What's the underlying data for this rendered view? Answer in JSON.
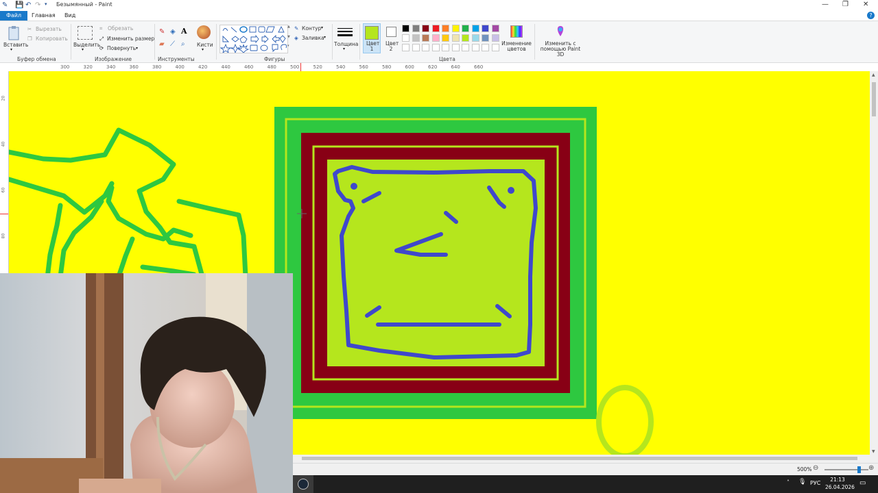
{
  "window": {
    "title": "Безымянный - Paint",
    "min_glyph": "—",
    "max_glyph": "❐",
    "close_glyph": "✕"
  },
  "menu": {
    "tabs": [
      {
        "label": "Файл",
        "active": true
      },
      {
        "label": "Главная",
        "active": false
      },
      {
        "label": "Вид",
        "active": false
      }
    ],
    "help_glyph": "?"
  },
  "ribbon": {
    "clipboard": {
      "group_label": "Буфер обмена",
      "paste": "Вставить",
      "cut": "Вырезать",
      "copy": "Копировать"
    },
    "image": {
      "group_label": "Изображение",
      "select": "Выделить",
      "crop": "Обрезать",
      "resize": "Изменить размер",
      "rotate": "Повернуть"
    },
    "tools": {
      "group_label": "Инструменты",
      "brushes": "Кисти"
    },
    "shapes": {
      "group_label": "Фигуры",
      "outline": "Контур",
      "fill": "Заливка"
    },
    "size": {
      "label": "Толщина"
    },
    "colors": {
      "group_label": "Цвета",
      "color1_label": "Цвет 1",
      "color2_label": "Цвет 2",
      "color1": "#b5e61d",
      "color2": "#ffffff",
      "edit_colors": "Изменение цветов",
      "paint3d": "Изменить с помощью Paint 3D",
      "palette_row1": [
        "#000000",
        "#7f7f7f",
        "#880015",
        "#ed1c24",
        "#ff7f27",
        "#fff200",
        "#22b14c",
        "#00a2e8",
        "#3f48cc",
        "#a349a4"
      ],
      "palette_row2": [
        "#ffffff",
        "#c3c3c3",
        "#b97a57",
        "#ffaec9",
        "#ffc90e",
        "#efe4b0",
        "#b5e61d",
        "#99d9ea",
        "#7092be",
        "#c8bfe7"
      ]
    }
  },
  "rulers": {
    "horizontal": [
      "300",
      "320",
      "340",
      "360",
      "380",
      "400",
      "420",
      "440",
      "460",
      "480",
      "500",
      "520",
      "540",
      "560",
      "580",
      "600",
      "620",
      "640",
      "660"
    ],
    "vertical": [
      "20",
      "40",
      "60",
      "80"
    ]
  },
  "statusbar": {
    "zoom": "500%",
    "zoom_level_fraction": 0.78
  },
  "taskbar": {
    "language": "РУС",
    "time": "21:13",
    "date": "26.04.2026"
  },
  "drawing": {
    "background": "#ffff00",
    "green": "#2ec840",
    "lime": "#b5e61d",
    "dark_red": "#880015",
    "blue": "#3f48cc"
  }
}
